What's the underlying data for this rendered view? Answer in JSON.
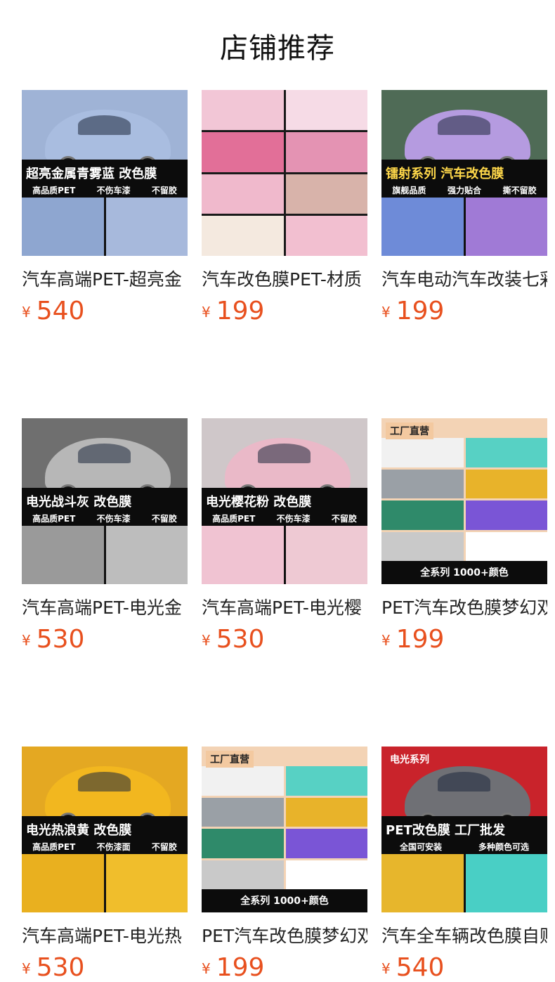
{
  "page_title": "店铺推荐",
  "currency": "¥",
  "products": [
    {
      "name": "汽车高端PET-超亮金",
      "price": "540",
      "style": "hero",
      "bg": "#9fb3d6",
      "car": "#a9bde0",
      "band": "超亮金属青雾蓝 改色膜",
      "sub": [
        "高品质PET",
        "不伤车漆",
        "不留胶"
      ],
      "minis": [
        "#8ea6d0",
        "#a7b9dc"
      ]
    },
    {
      "name": "汽车改色膜PET-材质",
      "price": "199",
      "style": "tiles",
      "bg": "#2b2b2b",
      "tiles": [
        "#f2c6d6",
        "#f6dbe6",
        "#e26f98",
        "#e493b3",
        "#f0b9cc",
        "#d8b3aa",
        "#f4e9df",
        "#f2bfd0"
      ]
    },
    {
      "name": "汽车电动汽车改装七彩",
      "price": "199",
      "style": "laser",
      "bg": "#4f6b56",
      "car": "#b59be0",
      "band": "镭射系列 汽车改色膜",
      "sub": [
        "旗舰品质",
        "强力贴合",
        "撕不留胶"
      ],
      "minis": [
        "#6e8bd8",
        "#a07ad6"
      ]
    },
    {
      "name": "汽车高端PET-电光金",
      "price": "530",
      "style": "hero",
      "bg": "#6f6f6f",
      "car": "#b7b7b7",
      "band": "电光战斗灰 改色膜",
      "sub": [
        "高品质PET",
        "不伤车漆",
        "不留胶"
      ],
      "minis": [
        "#9a9a9a",
        "#bdbdbd"
      ]
    },
    {
      "name": "汽车高端PET-电光樱",
      "price": "530",
      "style": "hero",
      "bg": "#cfc7c9",
      "car": "#eab9c8",
      "band": "电光樱花粉 改色膜",
      "sub": [
        "高品质PET",
        "不伤车漆",
        "不留胶"
      ],
      "minis": [
        "#f0c3d2",
        "#eec9d3"
      ]
    },
    {
      "name": "PET汽车改色膜梦幻双",
      "price": "199",
      "style": "factory",
      "bg": "#f3d3b5",
      "tag": "工厂直营",
      "tiles": [
        "#f1f1f1",
        "#57d1c4",
        "#9aa0a6",
        "#e8b32a",
        "#2f8a6a",
        "#7a55d6",
        "#c9c9c9",
        "#ffffff"
      ],
      "foot": "全系列 1000+颜色"
    },
    {
      "name": "汽车高端PET-电光热",
      "price": "530",
      "style": "hero",
      "bg": "#e4a822",
      "car": "#f2b71f",
      "band": "电光热浪黄 改色膜",
      "sub": [
        "高品质PET",
        "不伤漆面",
        "不留胶"
      ],
      "minis": [
        "#e9b01f",
        "#f0be2c"
      ]
    },
    {
      "name": "PET汽车改色膜梦幻双",
      "price": "199",
      "style": "factory",
      "bg": "#f3d3b5",
      "tag": "工厂直营",
      "tiles": [
        "#f1f1f1",
        "#57d1c4",
        "#9aa0a6",
        "#e8b32a",
        "#2f8a6a",
        "#7a55d6",
        "#c9c9c9",
        "#ffffff"
      ],
      "foot": "全系列 1000+颜色"
    },
    {
      "name": "汽车全车辆改色膜自贴",
      "price": "540",
      "style": "series",
      "bg": "#c9232b",
      "car": "#6f7075",
      "tag": "电光系列",
      "band": "PET改色膜 工厂批发",
      "sub": [
        "全国可安装",
        "多种颜色可选"
      ],
      "minis": [
        "#e7b62c",
        "#49cfc5"
      ]
    }
  ]
}
